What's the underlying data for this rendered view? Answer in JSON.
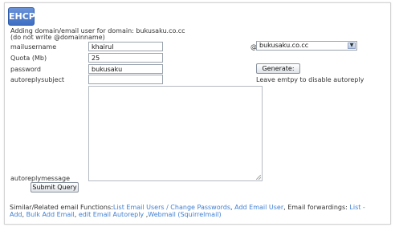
{
  "logo_text": "EHCP",
  "heading_line1": "Adding domain/email user for domain: bukusaku.co.cc",
  "heading_line2": "(do not write @domainname)",
  "labels": {
    "mailusername": "mailusername",
    "quota": "Quota (Mb)",
    "password": "password",
    "autoreplysubject": "autoreplysubject",
    "autoreplymessage": "autoreplymessage"
  },
  "values": {
    "mailusername": "khairul",
    "quota": "25",
    "password": "bukusaku",
    "autoreplysubject": "",
    "autoreplymessage": ""
  },
  "at_sign": "@",
  "domain_select": {
    "selected": "bukusaku.co.cc"
  },
  "generate_label": "Generate:",
  "hint_autoreply": "Leave emtpy to disable autoreply",
  "submit_label": "Submit Query",
  "footer": {
    "prefix": "Similar/Related email Functions:",
    "link1": "List Email Users / Change Passwords",
    "sep1": ", ",
    "link2": "Add Email User",
    "mid": ", Email forwardings: ",
    "link3": "List - Add",
    "sep2": ", ",
    "link4": "Bulk Add Email",
    "sep3": ", ",
    "link5": "edit Email Autoreply",
    "sep4": " ,",
    "link6": "Webmail (Squirrelmail)"
  }
}
